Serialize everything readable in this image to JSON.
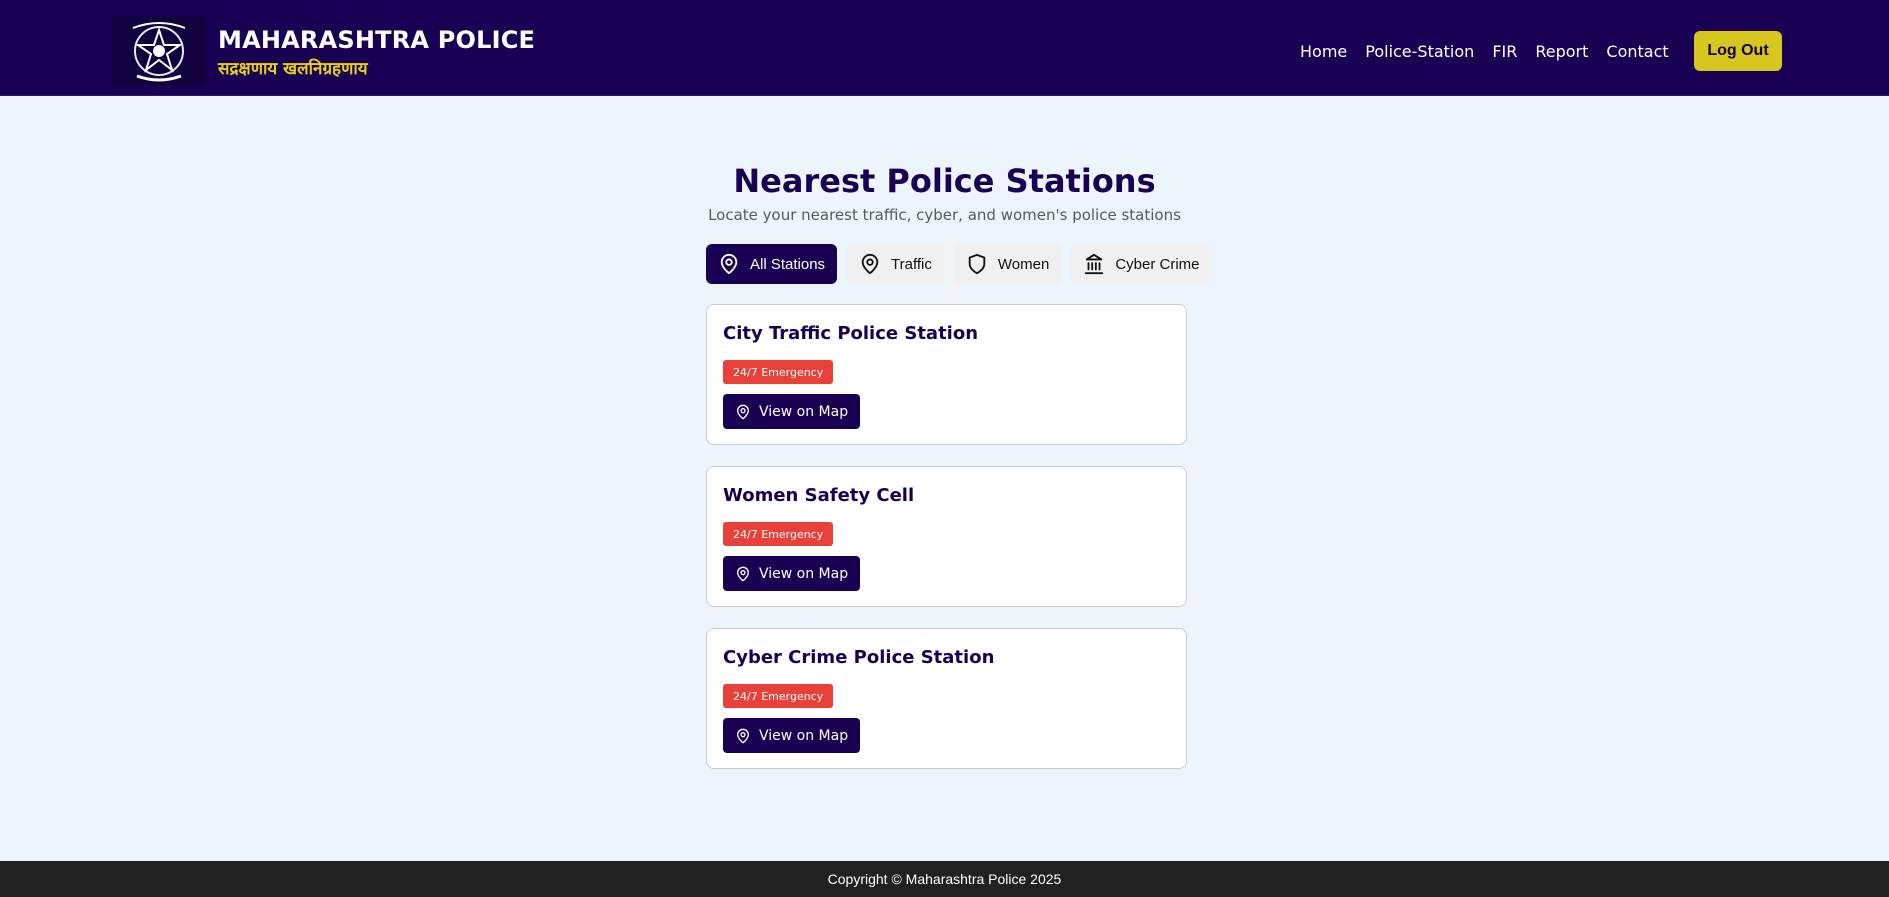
{
  "header": {
    "brand_title": "MAHARASHTRA POLICE",
    "brand_subtitle": "सद्रक्षणाय खलनिग्रहणाय",
    "nav": [
      "Home",
      "Police-Station",
      "FIR",
      "Report",
      "Contact"
    ],
    "logout_label": "Log Out"
  },
  "main": {
    "title": "Nearest Police Stations",
    "subtitle": "Locate your nearest traffic, cyber, and women's police stations",
    "filters": [
      {
        "label": "All Stations",
        "icon": "map-pin-icon",
        "active": true
      },
      {
        "label": "Traffic",
        "icon": "map-pin-icon",
        "active": false
      },
      {
        "label": "Women",
        "icon": "shield-icon",
        "active": false
      },
      {
        "label": "Cyber Crime",
        "icon": "bank-icon",
        "active": false
      }
    ],
    "stations": [
      {
        "name": "City Traffic Police Station",
        "badge": "24/7 Emergency",
        "button": "View on Map"
      },
      {
        "name": "Women Safety Cell",
        "badge": "24/7 Emergency",
        "button": "View on Map"
      },
      {
        "name": "Cyber Crime Police Station",
        "badge": "24/7 Emergency",
        "button": "View on Map"
      }
    ]
  },
  "footer": {
    "copyright": "Copyright © Maharashtra Police 2025"
  },
  "colors": {
    "primary": "#1a0052",
    "accent_yellow": "#d6c71f",
    "badge_red": "#e8413a",
    "background": "#ecf4fc",
    "footer": "#212121"
  }
}
